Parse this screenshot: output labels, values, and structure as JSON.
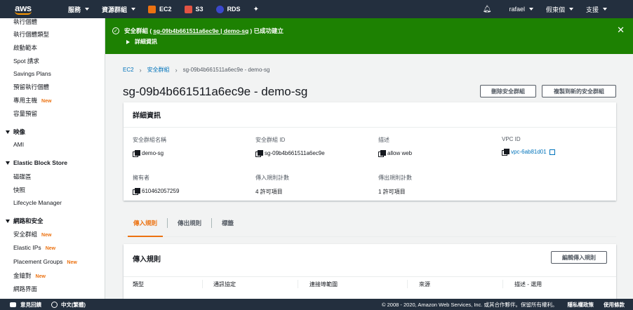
{
  "nav": {
    "logo": "aws",
    "services": "服務",
    "resource_groups": "資源群組",
    "pins": [
      {
        "label": "EC2",
        "color": "#ec7211"
      },
      {
        "label": "S3",
        "color": "#e25444"
      },
      {
        "label": "RDS",
        "color": "#3b48cc"
      }
    ],
    "user": "rafael",
    "account": "假東個",
    "support": "支援"
  },
  "sidebar": {
    "items": [
      {
        "label": "執行個體",
        "top": "-6"
      },
      {
        "label": "執行個體類型"
      },
      {
        "label": "啟動範本"
      },
      {
        "label": "Spot 請求"
      },
      {
        "label": "Savings Plans"
      },
      {
        "label": "預留執行個體"
      },
      {
        "label": "專用主機",
        "new": "New"
      },
      {
        "label": "容量預留"
      }
    ],
    "section_images": "映像",
    "images_items": [
      "AMI"
    ],
    "section_ebs": "Elastic Block Store",
    "ebs_items": [
      "磁碟區",
      "快照",
      "Lifecycle Manager"
    ],
    "section_network": "網路和安全",
    "network_items": [
      {
        "label": "安全群組",
        "new": "New"
      },
      {
        "label": "Elastic IPs",
        "new": "New"
      },
      {
        "label": "Placement Groups",
        "new": "New"
      },
      {
        "label": "金鑰對",
        "new": "New"
      },
      {
        "label": "網路界面"
      }
    ]
  },
  "flash": {
    "prefix": "安全群組 (",
    "link": "sg-09b4b661511a6ec9e | demo-sg",
    "suffix": ") 已成功建立",
    "details": "詳細資訊",
    "bg_color": "#1d8102"
  },
  "breadcrumb": {
    "root": "EC2",
    "parent": "安全群組",
    "current": "sg-09b4b661511a6ec9e - demo-sg"
  },
  "page": {
    "title": "sg-09b4b661511a6ec9e - demo-sg",
    "delete_button": "刪除安全群組",
    "copy_button": "複製到新的安全群組"
  },
  "details": {
    "header": "詳細資訊",
    "fields": {
      "name_label": "安全群組名稱",
      "name_value": "demo-sg",
      "id_label": "安全群組 ID",
      "id_value": "sg-09b4b661511a6ec9e",
      "desc_label": "描述",
      "desc_value": "allow web",
      "vpc_label": "VPC ID",
      "vpc_value": "vpc-6ab81d01",
      "owner_label": "擁有者",
      "owner_value": "610462057259",
      "inbound_count_label": "傳入規則計數",
      "inbound_count_value": "4 許可項目",
      "outbound_count_label": "傳出規則計數",
      "outbound_count_value": "1 許可項目"
    }
  },
  "tabs": [
    "傳入規則",
    "傳出規則",
    "標籤"
  ],
  "inbound": {
    "header": "傳入規則",
    "edit_button": "編輯傳入規則",
    "columns": [
      "類型",
      "通訊協定",
      "連接埠範圍",
      "來源",
      "描述 - 選用"
    ]
  },
  "footer": {
    "feedback": "意見回饋",
    "language": "中文(繁體)",
    "copyright": "© 2008 - 2020, Amazon Web Services, Inc. 或其合作夥伴。保留所有權利。",
    "privacy": "隱私權政策",
    "terms": "使用條款"
  }
}
